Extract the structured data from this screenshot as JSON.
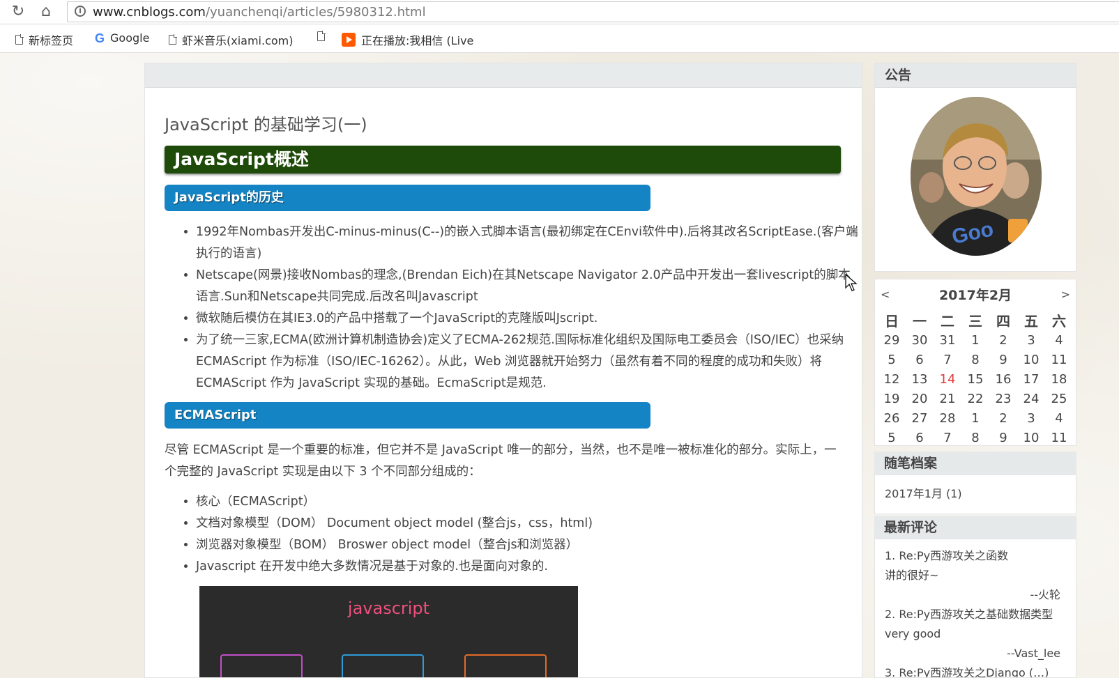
{
  "browser": {
    "reload_icon": "reload-icon",
    "home_icon": "home-icon",
    "url_host": "www.cnblogs.com",
    "url_path": "/yuanchenqi/articles/5980312.html",
    "bookmarks": [
      {
        "label": "新标签页",
        "icon": "page-icon"
      },
      {
        "label": "Google",
        "icon": "google-icon"
      },
      {
        "label": "虾米音乐(xiami.com)",
        "icon": "page-icon"
      },
      {
        "label": "",
        "icon": "page-icon"
      },
      {
        "label": "正在播放:我相信 (Live",
        "icon": "play-icon"
      }
    ]
  },
  "article": {
    "title": "JavaScript 的基础学习(一)",
    "h1": "JavaScript概述",
    "h2_history": "JavaScript的历史",
    "history_items": [
      "1992年Nombas开发出C-minus-minus(C--)的嵌入式脚本语言(最初绑定在CEnvi软件中).后将其改名ScriptEase.(客户端执行的语言)",
      "Netscape(网景)接收Nombas的理念,(Brendan Eich)在其Netscape Navigator 2.0产品中开发出一套livescript的脚本语言.Sun和Netscape共同完成.后改名叫Javascript",
      "微软随后模仿在其IE3.0的产品中搭载了一个JavaScript的克隆版叫Jscript.",
      "为了统一三家,ECMA(欧洲计算机制造协会)定义了ECMA-262规范.国际标准化组织及国际电工委员会（ISO/IEC）也采纳 ECMAScript 作为标准（ISO/IEC-16262）。从此，Web 浏览器就开始努力（虽然有着不同的程度的成功和失败）将 ECMAScript 作为 JavaScript 实现的基础。EcmaScript是规范."
    ],
    "h2_ecma": "ECMAScript",
    "ecma_paragraph": "尽管 ECMAScript 是一个重要的标准，但它并不是 JavaScript 唯一的部分，当然，也不是唯一被标准化的部分。实际上，一个完整的 JavaScript 实现是由以下 3 个不同部分组成的：",
    "ecma_items": [
      "核心（ECMAScript）",
      "文档对象模型（DOM） Document object model (整合js，css，html)",
      "浏览器对象模型（BOM） Broswer object model（整合js和浏览器）",
      "Javascript 在开发中绝大多数情况是基于对象的.也是面向对象的."
    ],
    "diagram_title": "javascript"
  },
  "sidebar": {
    "notice_title": "公告",
    "calendar": {
      "prev": "<",
      "next": ">",
      "title": "2017年2月",
      "weekdays": [
        "日",
        "一",
        "二",
        "三",
        "四",
        "五",
        "六"
      ],
      "weeks": [
        [
          "29",
          "30",
          "31",
          "1",
          "2",
          "3",
          "4"
        ],
        [
          "5",
          "6",
          "7",
          "8",
          "9",
          "10",
          "11"
        ],
        [
          "12",
          "13",
          "14",
          "15",
          "16",
          "17",
          "18"
        ],
        [
          "19",
          "20",
          "21",
          "22",
          "23",
          "24",
          "25"
        ],
        [
          "26",
          "27",
          "28",
          "1",
          "2",
          "3",
          "4"
        ],
        [
          "5",
          "6",
          "7",
          "8",
          "9",
          "10",
          "11"
        ]
      ],
      "today": "14"
    },
    "archive_title": "随笔档案",
    "archive_item": "2017年1月 (1)",
    "comments_title": "最新评论",
    "comments": [
      {
        "title": "1. Re:Py西游攻关之函数",
        "body": "讲的很好~",
        "author": "--火轮"
      },
      {
        "title": "2. Re:Py西游攻关之基础数据类型",
        "body": "very good",
        "author": "--Vast_lee"
      },
      {
        "title": "3. Re:Py西游攻关之Django (…)",
        "body": "",
        "author": ""
      }
    ]
  },
  "colors": {
    "h1_bg": "#1e4a0a",
    "h2_bg": "#1484c4",
    "today": "#e23b3b",
    "diagram_title": "#ee4f7e"
  }
}
